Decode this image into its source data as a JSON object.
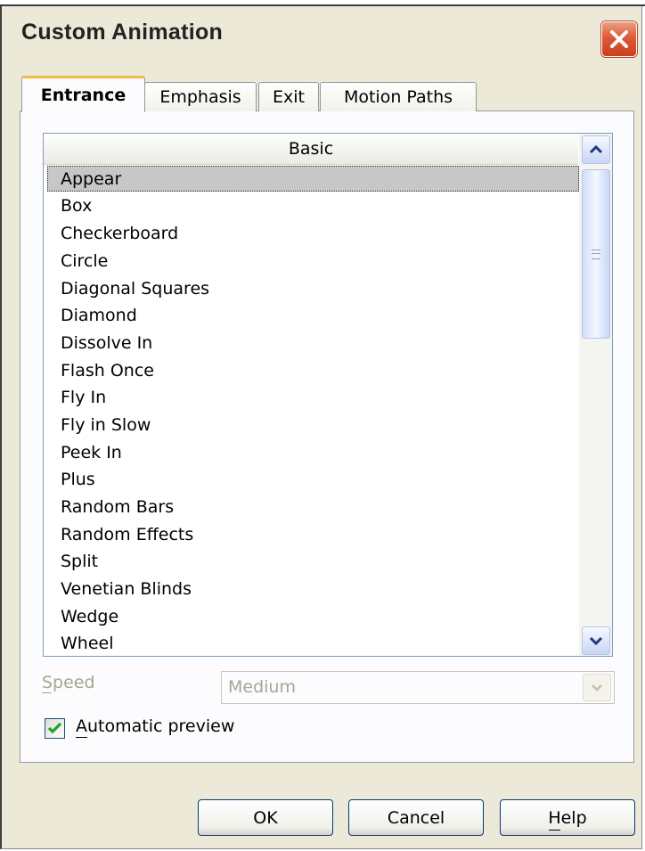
{
  "window": {
    "title": "Custom Animation"
  },
  "tabs": [
    {
      "label": "Entrance",
      "active": true
    },
    {
      "label": "Emphasis",
      "active": false
    },
    {
      "label": "Exit",
      "active": false
    },
    {
      "label": "Motion Paths",
      "active": false
    }
  ],
  "effects": {
    "header": "Basic",
    "selected": "Appear",
    "items": [
      "Appear",
      "Box",
      "Checkerboard",
      "Circle",
      "Diagonal Squares",
      "Diamond",
      "Dissolve In",
      "Flash Once",
      "Fly In",
      "Fly in Slow",
      "Peek In",
      "Plus",
      "Random Bars",
      "Random Effects",
      "Split",
      "Venetian Blinds",
      "Wedge",
      "Wheel"
    ]
  },
  "speed": {
    "label": "Speed",
    "value": "Medium",
    "enabled": false
  },
  "preview": {
    "label": "Automatic preview",
    "checked": true
  },
  "buttons": {
    "ok": "OK",
    "cancel": "Cancel",
    "help": "Help"
  },
  "icons": {
    "close": "close-icon",
    "scroll_up": "chevron-up-icon",
    "scroll_down": "chevron-down-icon",
    "dropdown": "chevron-down-icon",
    "check": "checkmark-icon"
  },
  "colors": {
    "close_button": "#de5a36",
    "tab_highlight": "#f6b94a",
    "selection": "#c7c7c7",
    "check": "#21a121"
  }
}
